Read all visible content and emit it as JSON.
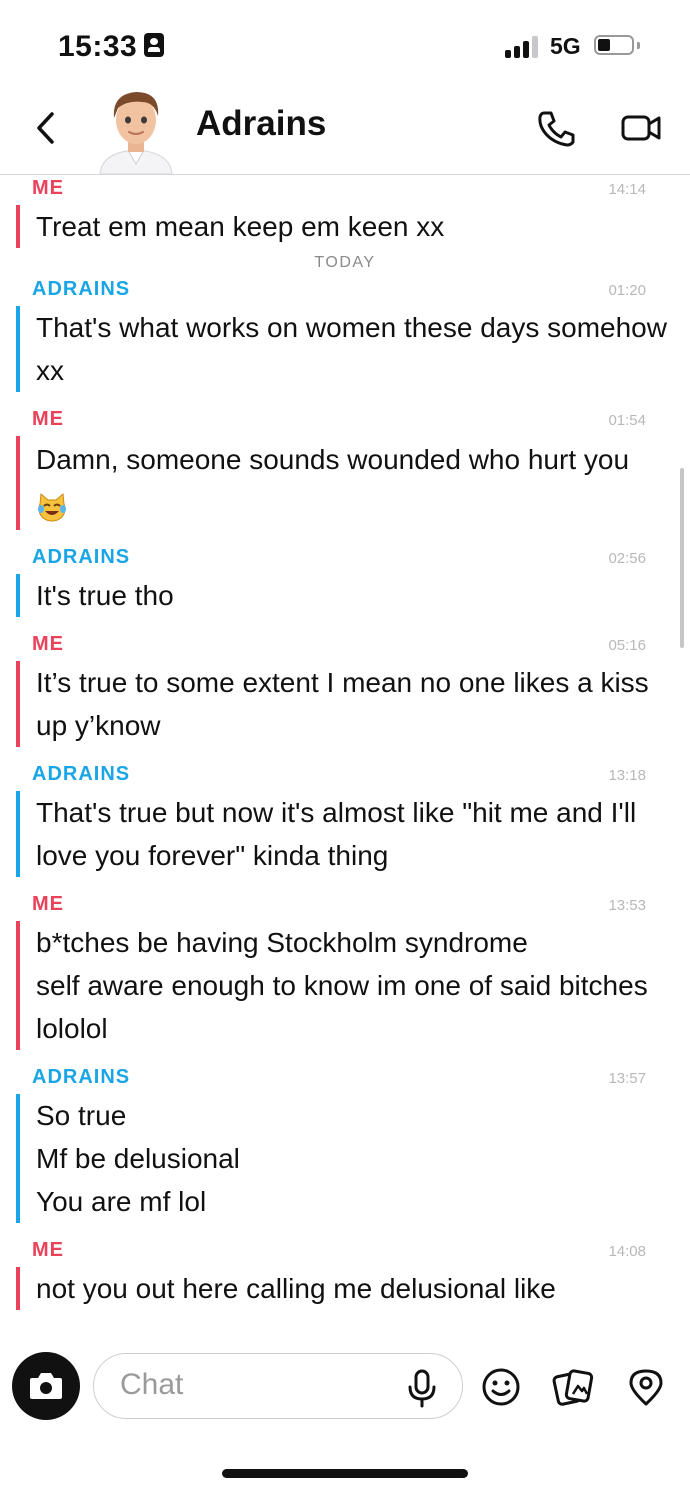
{
  "status_bar": {
    "time": "15:33",
    "network": "5G",
    "battery_level": 0.35
  },
  "header": {
    "contact_name": "Adrains"
  },
  "day_separator": "TODAY",
  "messages": [
    {
      "sender": "ME",
      "time": "14:14",
      "text": "Treat em mean keep em keen xx"
    },
    {
      "sender": "ADRAINS",
      "time": "01:20",
      "text": "That's what works on women these days somehow xx"
    },
    {
      "sender": "ME",
      "time": "01:54",
      "text": "Damn, someone sounds wounded who hurt you"
    },
    {
      "sender": "ADRAINS",
      "time": "02:56",
      "text": "It's true tho"
    },
    {
      "sender": "ME",
      "time": "05:16",
      "text": "It’s true to some extent I mean no one likes a kiss up y’know"
    },
    {
      "sender": "ADRAINS",
      "time": "13:18",
      "text": "That's true but now it's almost like \"hit me and I'll love you forever\" kinda thing"
    },
    {
      "sender": "ME",
      "time": "13:53",
      "text": "b*tches be having Stockholm syndrome\nself aware enough to know im one of said bitches lololol"
    },
    {
      "sender": "ADRAINS",
      "time": "13:57",
      "text": "So true\nMf be delusional\nYou are mf lol"
    },
    {
      "sender": "ME",
      "time": "14:08",
      "text": "not you out here calling me delusional like"
    }
  ],
  "composer": {
    "placeholder": "Chat"
  },
  "colors": {
    "me": "#e9425a",
    "them": "#1aa6e6"
  }
}
